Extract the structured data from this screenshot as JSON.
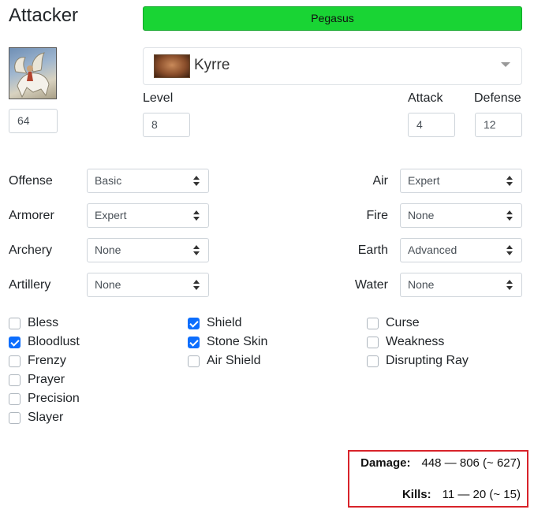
{
  "title": "Attacker",
  "unit": {
    "name": "Pegasus",
    "count": "64",
    "color": "#19d434"
  },
  "hero": {
    "name": "Kyrre"
  },
  "stats": {
    "level_label": "Level",
    "level": "8",
    "attack_label": "Attack",
    "attack": "4",
    "defense_label": "Defense",
    "defense": "12"
  },
  "skills_left": [
    {
      "label": "Offense",
      "value": "Basic"
    },
    {
      "label": "Armorer",
      "value": "Expert"
    },
    {
      "label": "Archery",
      "value": "None"
    },
    {
      "label": "Artillery",
      "value": "None"
    }
  ],
  "skills_right": [
    {
      "label": "Air",
      "value": "Expert"
    },
    {
      "label": "Fire",
      "value": "None"
    },
    {
      "label": "Earth",
      "value": "Advanced"
    },
    {
      "label": "Water",
      "value": "None"
    }
  ],
  "spells_col1": [
    {
      "label": "Bless",
      "checked": false
    },
    {
      "label": "Bloodlust",
      "checked": true
    },
    {
      "label": "Frenzy",
      "checked": false
    },
    {
      "label": "Prayer",
      "checked": false
    },
    {
      "label": "Precision",
      "checked": false
    },
    {
      "label": "Slayer",
      "checked": false
    }
  ],
  "spells_col2": [
    {
      "label": "Shield",
      "checked": true
    },
    {
      "label": "Stone Skin",
      "checked": true
    },
    {
      "label": "Air Shield",
      "checked": false
    }
  ],
  "spells_col3": [
    {
      "label": "Curse",
      "checked": false
    },
    {
      "label": "Weakness",
      "checked": false
    },
    {
      "label": "Disrupting Ray",
      "checked": false
    }
  ],
  "result": {
    "damage_label": "Damage:",
    "damage": "448 — 806 (~ 627)",
    "kills_label": "Kills:",
    "kills": "11 — 20 (~ 15)"
  }
}
